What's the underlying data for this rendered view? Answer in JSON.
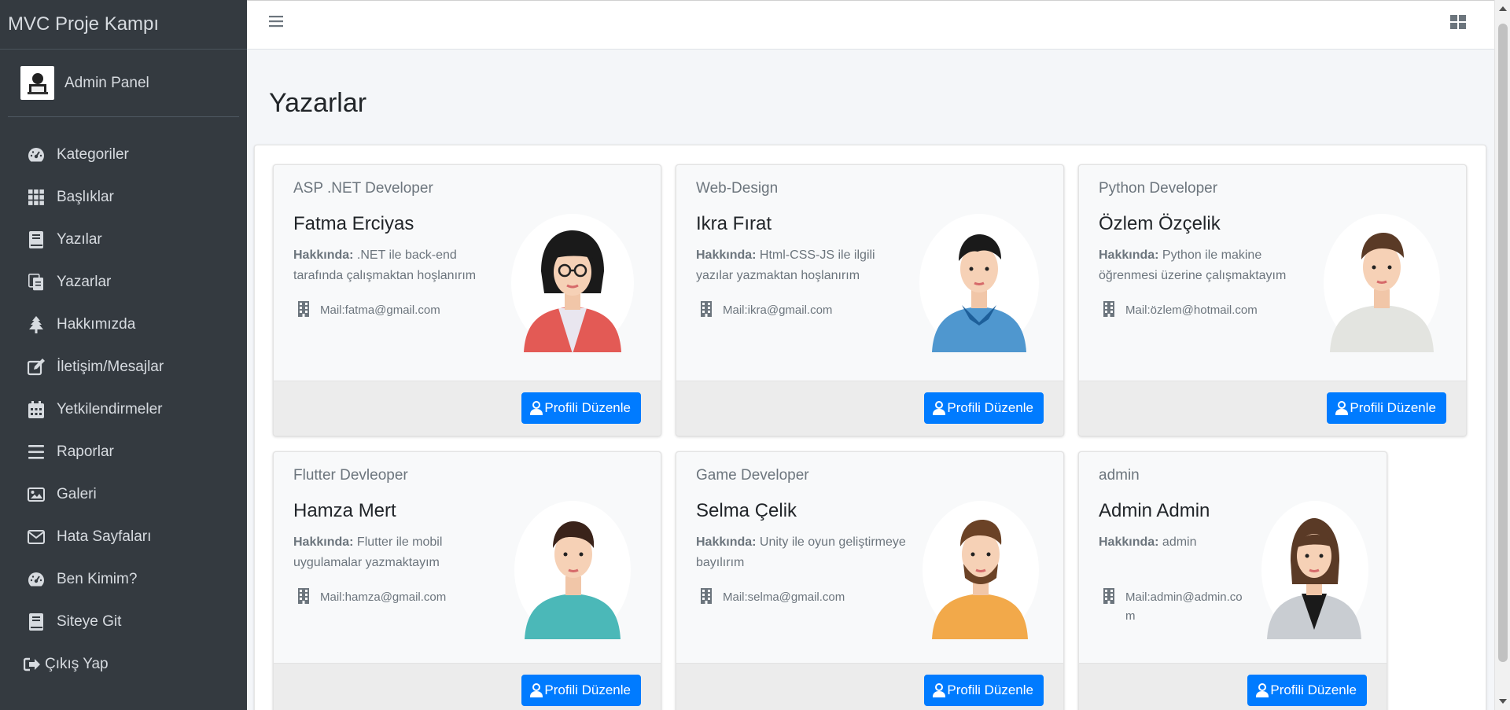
{
  "brand": {
    "title": "MVC Proje Kampı"
  },
  "user": {
    "name": "Admin Panel"
  },
  "nav": [
    {
      "label": "Kategoriler",
      "icon": "dashboard-gauge-icon"
    },
    {
      "label": "Başlıklar",
      "icon": "grid-icon"
    },
    {
      "label": "Yazılar",
      "icon": "book-icon"
    },
    {
      "label": "Yazarlar",
      "icon": "copy-icon"
    },
    {
      "label": "Hakkımızda",
      "icon": "tree-icon"
    },
    {
      "label": "İletişim/Mesajlar",
      "icon": "edit-icon"
    },
    {
      "label": "Yetkilendirmeler",
      "icon": "calendar-icon"
    },
    {
      "label": "Raporlar",
      "icon": "bars-icon"
    },
    {
      "label": "Galeri",
      "icon": "image-icon"
    },
    {
      "label": "Hata Sayfaları",
      "icon": "envelope-icon"
    },
    {
      "label": "Ben Kimim?",
      "icon": "dashboard-gauge-icon"
    },
    {
      "label": "Siteye Git",
      "icon": "book-icon"
    },
    {
      "label": "Çıkış Yap",
      "icon": "sign-out-icon"
    }
  ],
  "page": {
    "title": "Yazarlar"
  },
  "about_label": "Hakkında:",
  "edit_label": "Profili Düzenle",
  "writers": [
    {
      "role": "ASP .NET Developer",
      "name": "Fatma Erciyas",
      "about": ".NET ile back-end tarafında çalışmaktan hoşlanırım",
      "mail": "Mail:fatma@gmail.com",
      "avatar": "female-avatar-red-jacket-glasses"
    },
    {
      "role": "Web-Design",
      "name": "Ikra Fırat",
      "about": "Html-CSS-JS ile ilgili yazılar yazmaktan hoşlanırım",
      "mail": "Mail:ikra@gmail.com",
      "avatar": "male-avatar-blue-shirt-scarf"
    },
    {
      "role": "Python Developer",
      "name": "Özlem Özçelik",
      "about": "Python ile makine öğrenmesi üzerine çalışmaktayım",
      "mail": "Mail:özlem@hotmail.com",
      "avatar": "male-avatar-grey-sweater"
    },
    {
      "role": "Flutter Devleoper",
      "name": "Hamza Mert",
      "about": "Flutter ile mobil uygulamalar yazmaktayım",
      "mail": "Mail:hamza@gmail.com",
      "avatar": "male-avatar-teal-shirt"
    },
    {
      "role": "Game Developer",
      "name": "Selma Çelik",
      "about": "Unity ile oyun geliştirmeye bayılırım",
      "mail": "Mail:selma@gmail.com",
      "avatar": "male-avatar-orange-sweater-beard"
    },
    {
      "role": "admin",
      "name": "Admin Admin",
      "about": "admin",
      "mail": "Mail:admin@admin.com",
      "avatar": "female-avatar-grey-blazer"
    }
  ],
  "colors": {
    "sidebar": "#343a40",
    "primary": "#007bff",
    "background": "#f4f6f9"
  }
}
